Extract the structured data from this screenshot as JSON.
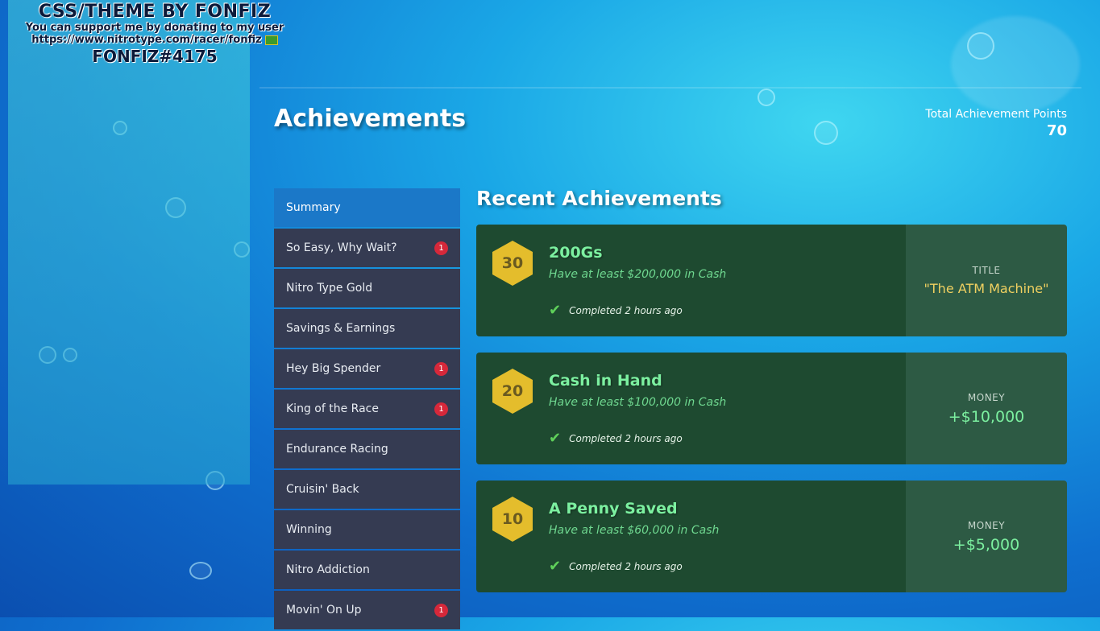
{
  "banner": {
    "line1": "CSS/THEME BY FONFIZ",
    "line2": "You can support me by donating to my user",
    "line3": "https://www.nitrotype.com/racer/fonfiz",
    "line4": "FONFIZ#4175"
  },
  "header": {
    "title": "Achievements",
    "points_label": "Total Achievement Points",
    "points_value": "70"
  },
  "categories": [
    {
      "label": "Summary",
      "badge": ""
    },
    {
      "label": "So Easy, Why Wait?",
      "badge": "1"
    },
    {
      "label": "Nitro Type Gold",
      "badge": ""
    },
    {
      "label": "Savings & Earnings",
      "badge": ""
    },
    {
      "label": "Hey Big Spender",
      "badge": "1"
    },
    {
      "label": "King of the Race",
      "badge": "1"
    },
    {
      "label": "Endurance Racing",
      "badge": ""
    },
    {
      "label": "Cruisin' Back",
      "badge": ""
    },
    {
      "label": "Winning",
      "badge": ""
    },
    {
      "label": "Nitro Addiction",
      "badge": ""
    },
    {
      "label": "Movin' On Up",
      "badge": "1"
    }
  ],
  "recent": {
    "title": "Recent Achievements",
    "items": [
      {
        "points": "30",
        "name": "200Gs",
        "desc": "Have at least $200,000 in Cash",
        "completed": "Completed 2 hours ago",
        "reward_type": "TITLE",
        "reward_value": "\"The ATM Machine\""
      },
      {
        "points": "20",
        "name": "Cash in Hand",
        "desc": "Have at least $100,000 in Cash",
        "completed": "Completed 2 hours ago",
        "reward_type": "MONEY",
        "reward_value": "+$10,000"
      },
      {
        "points": "10",
        "name": "A Penny Saved",
        "desc": "Have at least $60,000 in Cash",
        "completed": "Completed 2 hours ago",
        "reward_type": "MONEY",
        "reward_value": "+$5,000"
      }
    ]
  },
  "icons": {
    "check": "check-icon",
    "cash": "cash-icon"
  },
  "colors": {
    "active_tab": "#1b78c8",
    "card_bg": "#1e4a30",
    "badge": "#d6283a",
    "points_hex": "#e4bd2c"
  }
}
